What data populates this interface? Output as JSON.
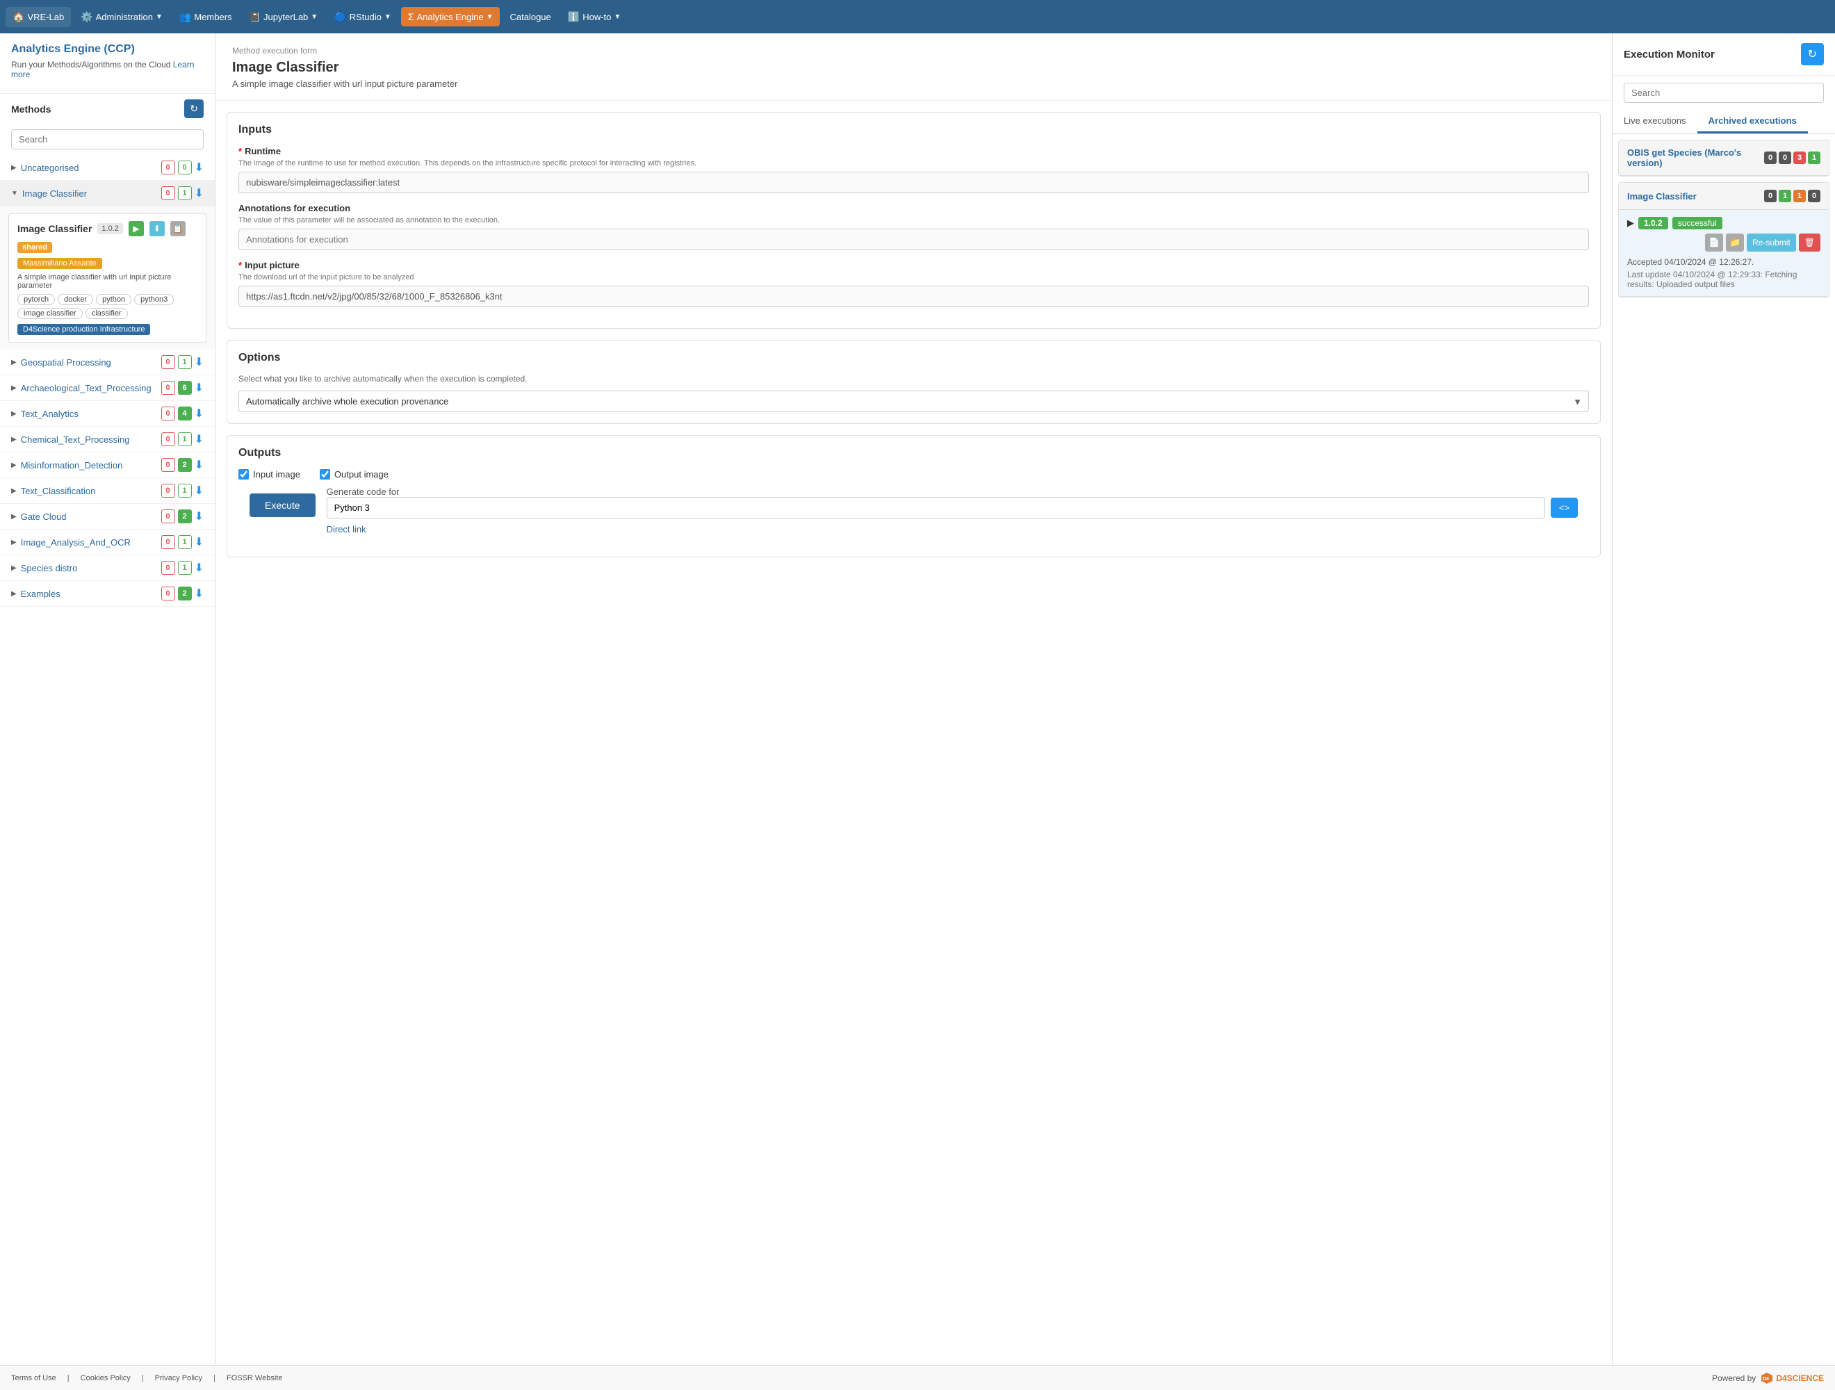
{
  "nav": {
    "items": [
      {
        "label": "VRE-Lab",
        "icon": "🏠",
        "active": false,
        "hasDropdown": false
      },
      {
        "label": "Administration",
        "icon": "⚙️",
        "active": false,
        "hasDropdown": true
      },
      {
        "label": "Members",
        "icon": "👥",
        "active": false,
        "hasDropdown": false
      },
      {
        "label": "JupyterLab",
        "icon": "📓",
        "active": false,
        "hasDropdown": true
      },
      {
        "label": "RStudio",
        "icon": "🔵",
        "active": false,
        "hasDropdown": true
      },
      {
        "label": "Analytics Engine",
        "icon": "Σ",
        "active": true,
        "hasDropdown": true
      },
      {
        "label": "Catalogue",
        "icon": "",
        "active": false,
        "hasDropdown": false
      },
      {
        "label": "How-to",
        "icon": "ℹ️",
        "active": false,
        "hasDropdown": true
      }
    ]
  },
  "left_panel": {
    "title": "Analytics Engine (CCP)",
    "subtitle": "Run your Methods/Algorithms on the Cloud",
    "learn_more": "Learn more",
    "methods_label": "Methods",
    "search_placeholder": "Search",
    "categories": [
      {
        "name": "Uncategorised",
        "badge_red": "0",
        "badge_green": "0",
        "expanded": false
      },
      {
        "name": "Image Classifier",
        "badge_red": "0",
        "badge_green": "1",
        "expanded": true
      },
      {
        "name": "Geospatial Processing",
        "badge_red": "0",
        "badge_green": "1",
        "expanded": false
      },
      {
        "name": "Archaeological_Text_Processing",
        "badge_red": "0",
        "badge_green": "6",
        "expanded": false
      },
      {
        "name": "Text_Analytics",
        "badge_red": "0",
        "badge_green": "4",
        "expanded": false
      },
      {
        "name": "Chemical_Text_Processing",
        "badge_red": "0",
        "badge_green": "1",
        "expanded": false
      },
      {
        "name": "Misinformation_Detection",
        "badge_red": "0",
        "badge_green": "2",
        "expanded": false
      },
      {
        "name": "Text_Classification",
        "badge_red": "0",
        "badge_green": "1",
        "expanded": false
      },
      {
        "name": "Gate Cloud",
        "badge_red": "0",
        "badge_green": "2",
        "expanded": false
      },
      {
        "name": "Image_Analysis_And_OCR",
        "badge_red": "0",
        "badge_green": "1",
        "expanded": false
      },
      {
        "name": "Species distro",
        "badge_red": "0",
        "badge_green": "1",
        "expanded": false
      },
      {
        "name": "Examples",
        "badge_red": "0",
        "badge_green": "2",
        "expanded": false
      }
    ],
    "method_card": {
      "name": "Image Classifier",
      "version": "1.0.2",
      "author": "Massimiliano Assante",
      "description": "A simple image classifier with url input picture parameter",
      "tags": [
        "pytorch",
        "docker",
        "python",
        "python3",
        "image classifier",
        "classifier"
      ],
      "infrastructure": "D4Science production Infrastructure",
      "shared_label": "shared"
    }
  },
  "middle_panel": {
    "breadcrumb": "Method execution form",
    "title": "Image Classifier",
    "subtitle": "A simple image classifier with url input picture parameter",
    "inputs_section": "Inputs",
    "runtime_label": "Runtime",
    "runtime_desc": "The image of the runtime to use for method execution. This depends on the infrastructure specific protocol for interacting with registries.",
    "runtime_value": "nubisware/simpleimageclassifier:latest",
    "annotations_label": "Annotations for execution",
    "annotations_desc": "The value of this parameter will be associated as annotation to the execution.",
    "annotations_placeholder": "Annotations for execution",
    "input_picture_label": "Input picture",
    "input_picture_desc": "The download url of the input picture to be analyzed",
    "input_picture_value": "https://as1.ftcdn.net/v2/jpg/00/85/32/68/1000_F_85326806_k3nt",
    "options_section": "Options",
    "options_desc": "Select what you like to archive automatically when the execution is completed.",
    "archive_option": "Automatically archive whole execution provenance",
    "outputs_section": "Outputs",
    "output_input_image_label": "Input image",
    "output_output_image_label": "Output image",
    "execute_label": "Execute",
    "code_gen_label": "Generate code for",
    "code_gen_value": "Python 3",
    "direct_link_label": "Direct link"
  },
  "right_panel": {
    "title": "Execution Monitor",
    "search_placeholder": "Search",
    "tab_live": "Live executions",
    "tab_archived": "Archived executions",
    "executions": [
      {
        "name": "OBIS get Species (Marco's version)",
        "badges": [
          {
            "value": "0",
            "color": "#555"
          },
          {
            "value": "0",
            "color": "#555"
          },
          {
            "value": "3",
            "color": "#e05252"
          },
          {
            "value": "1",
            "color": "#4caf50"
          }
        ]
      },
      {
        "name": "Image Classifier",
        "badges": [
          {
            "value": "0",
            "color": "#555"
          },
          {
            "value": "1",
            "color": "#4caf50"
          },
          {
            "value": "1",
            "color": "#e07a30"
          },
          {
            "value": "0",
            "color": "#555"
          }
        ],
        "expanded": true,
        "version": "1.0.2",
        "status": "successful",
        "accepted": "Accepted 04/10/2024 @ 12:26:27.",
        "last_update": "Last update 04/10/2024 @ 12:29:33:  Fetching results: Uploaded output files"
      }
    ]
  },
  "footer": {
    "links": [
      "Terms of Use",
      "Cookies Policy",
      "Privacy Policy",
      "FOSSR Website"
    ],
    "powered_by": "Powered by",
    "brand": "D4SCIENCE"
  }
}
